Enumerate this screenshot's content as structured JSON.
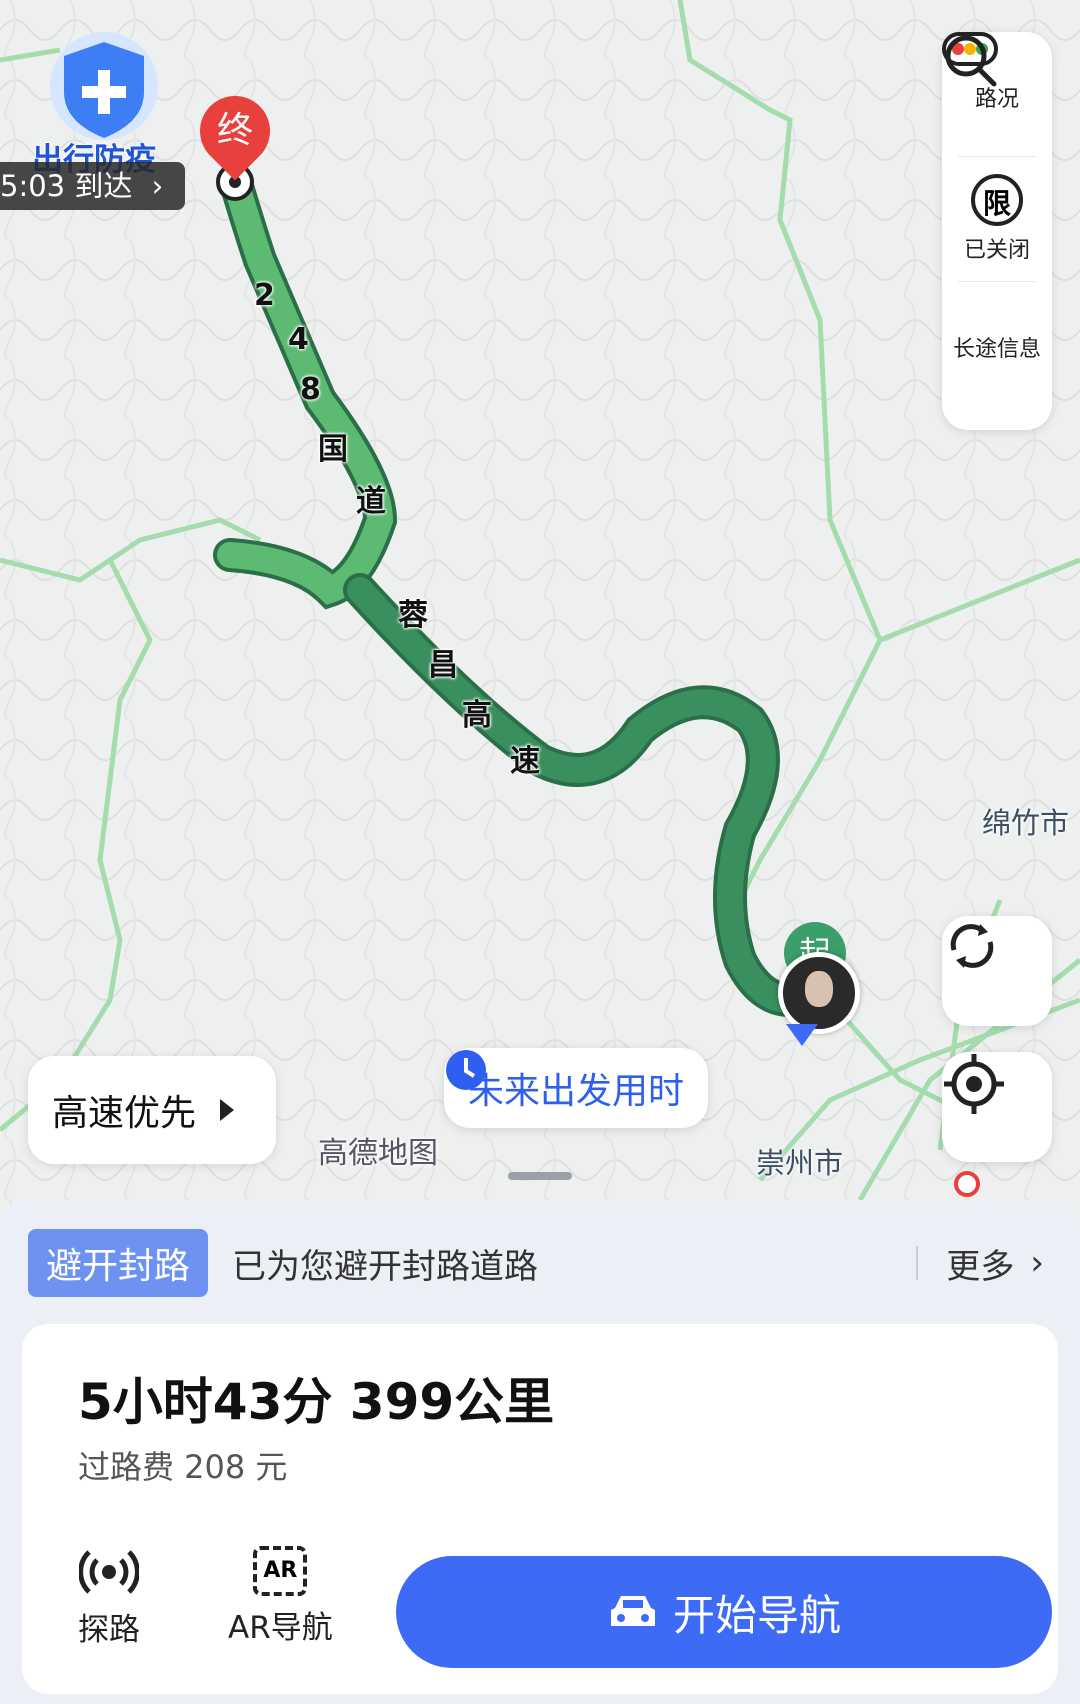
{
  "map": {
    "brand": "高德地图",
    "cities": [
      {
        "name": "绵竹市"
      },
      {
        "name": "崇州市"
      }
    ],
    "road_labels": {
      "national_road": [
        "2",
        "4",
        "8",
        "国",
        "道"
      ],
      "expressway": [
        "蓉",
        "昌",
        "高",
        "速"
      ]
    },
    "end_marker": "终",
    "start_marker": "起",
    "route_color": "#3a8f5f"
  },
  "overlay": {
    "epidemic_badge": "出行防疫",
    "eta_text": "5:03 到达",
    "eta_chevron": "›",
    "future_departure": "未来出发用时",
    "route_pref": "高速优先"
  },
  "side_tools": [
    {
      "icon": "traffic-light-icon",
      "label": "路况"
    },
    {
      "icon": "restriction-icon",
      "label": "已关闭",
      "glyph": "限"
    },
    {
      "icon": "search-icon",
      "label": "长途信息"
    }
  ],
  "panel": {
    "notice_tag": "避开封路",
    "notice_text": "已为您避开封路道路",
    "more": "更多",
    "duration_distance": "5小时43分  399公里",
    "toll": "过路费 208 元",
    "actions": [
      {
        "icon": "radar-icon",
        "label": "探路"
      },
      {
        "icon": "ar-icon",
        "label": "AR导航",
        "glyph": "AR"
      }
    ],
    "start_nav": "开始导航"
  },
  "colors": {
    "accent": "#3d6bf5",
    "route": "#3a8f5f",
    "destination": "#e8403d"
  }
}
